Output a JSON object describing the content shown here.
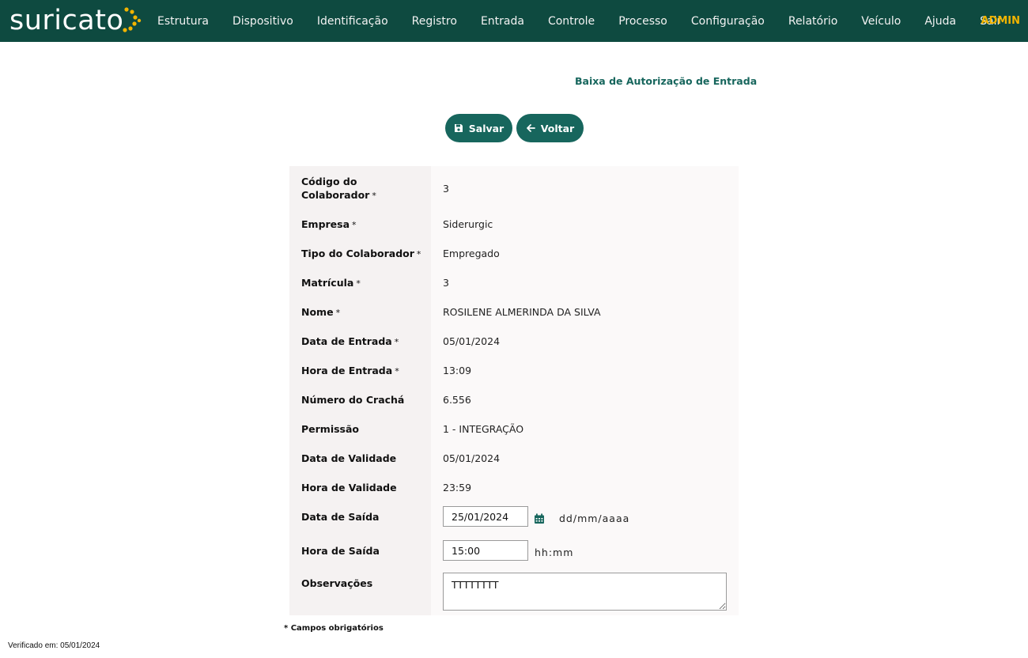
{
  "brand": {
    "logo_text": "suricato",
    "accent": "#f1b400",
    "bar_color": "#0e4a40",
    "primary": "#17665d"
  },
  "nav": {
    "items": [
      "Estrutura",
      "Dispositivo",
      "Identificação",
      "Registro",
      "Entrada",
      "Controle",
      "Processo",
      "Configuração",
      "Relatório",
      "Veículo",
      "Ajuda",
      "Sair"
    ],
    "user": "ADMIN"
  },
  "page": {
    "title": "Baixa de Autorização de Entrada"
  },
  "actions": {
    "save_label": "Salvar",
    "back_label": "Voltar"
  },
  "form": {
    "codigo": {
      "label": "Código do Colaborador",
      "value": "3",
      "required": "*"
    },
    "empresa": {
      "label": "Empresa",
      "value": "Siderurgic",
      "required": "*"
    },
    "tipo": {
      "label": "Tipo do Colaborador",
      "value": "Empregado",
      "required": "*"
    },
    "matricula": {
      "label": "Matrícula",
      "value": "3",
      "required": "*"
    },
    "nome": {
      "label": "Nome",
      "value": "ROSILENE ALMERINDA DA SILVA",
      "required": "*"
    },
    "data_entrada": {
      "label": "Data de Entrada",
      "value": "05/01/2024",
      "required": "*"
    },
    "hora_entrada": {
      "label": "Hora de Entrada",
      "value": "13:09",
      "required": "*"
    },
    "cracha": {
      "label": "Número do Crachá",
      "value": "6.556"
    },
    "permissao": {
      "label": "Permissão",
      "value": "1 - INTEGRAÇÃO"
    },
    "data_validade": {
      "label": "Data de Validade",
      "value": "05/01/2024"
    },
    "hora_validade": {
      "label": "Hora de Validade",
      "value": "23:59"
    },
    "data_saida": {
      "label": "Data de Saída",
      "value": "25/01/2024",
      "hint": "dd/mm/aaaa"
    },
    "hora_saida": {
      "label": "Hora de Saída",
      "value": "15:00",
      "hint": "hh:mm"
    },
    "observacoes": {
      "label": "Observações",
      "value": "TTTTTTTT"
    }
  },
  "footer": {
    "note": "* Campos obrigatórios",
    "verified": "Verificado em: 05/01/2024"
  }
}
